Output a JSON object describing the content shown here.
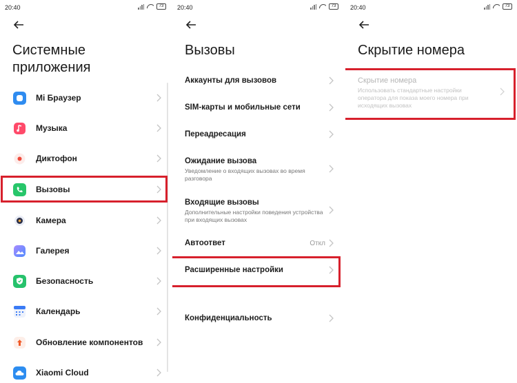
{
  "status_bar": {
    "time": "20:40",
    "battery": "73"
  },
  "panel1": {
    "title_line1": "Системные",
    "title_line2": "приложения",
    "items": [
      {
        "label": "Mi Браузер",
        "icon": "browser-icon",
        "color": "#2f8cf0"
      },
      {
        "label": "Музыка",
        "icon": "music-icon",
        "color": "#ff3b5c"
      },
      {
        "label": "Диктофон",
        "icon": "recorder-icon",
        "color": "#ef4a3c"
      },
      {
        "label": "Вызовы",
        "icon": "phone-icon",
        "color": "#27c66a"
      },
      {
        "label": "Камера",
        "icon": "camera-icon",
        "color": "#3a3f5a"
      },
      {
        "label": "Галерея",
        "icon": "gallery-icon",
        "color": "#6b8cff"
      },
      {
        "label": "Безопасность",
        "icon": "shield-icon",
        "color": "#27c26c"
      },
      {
        "label": "Календарь",
        "icon": "calendar-icon",
        "color": "#3a7bf5"
      },
      {
        "label": "Обновление компонентов",
        "icon": "update-icon",
        "color": "#f05a28"
      },
      {
        "label": "Xiaomi Cloud",
        "icon": "cloud-icon",
        "color": "#2d8df0"
      }
    ]
  },
  "panel2": {
    "title": "Вызовы",
    "items": [
      {
        "label": "Аккаунты для вызовов"
      },
      {
        "label": "SIM-карты и мобильные сети"
      },
      {
        "label": "Переадресация"
      },
      {
        "label": "Ожидание вызова",
        "sub": "Уведомление о входящих вызовах во время разговора"
      },
      {
        "label": "Входящие вызовы",
        "sub": "Дополнительные настройки поведения устройства при входящих вызовах"
      },
      {
        "label": "Автоответ",
        "value": "Откл"
      },
      {
        "label": "Расширенные настройки"
      },
      {
        "label": "Конфиденциальность"
      }
    ]
  },
  "panel3": {
    "title": "Скрытие номера",
    "item": {
      "label": "Скрытие номера",
      "sub": "Использовать стандартные настройки оператора для показа моего номера при исходящих вызовах"
    }
  },
  "colors": {
    "highlight": "#d7202c"
  }
}
